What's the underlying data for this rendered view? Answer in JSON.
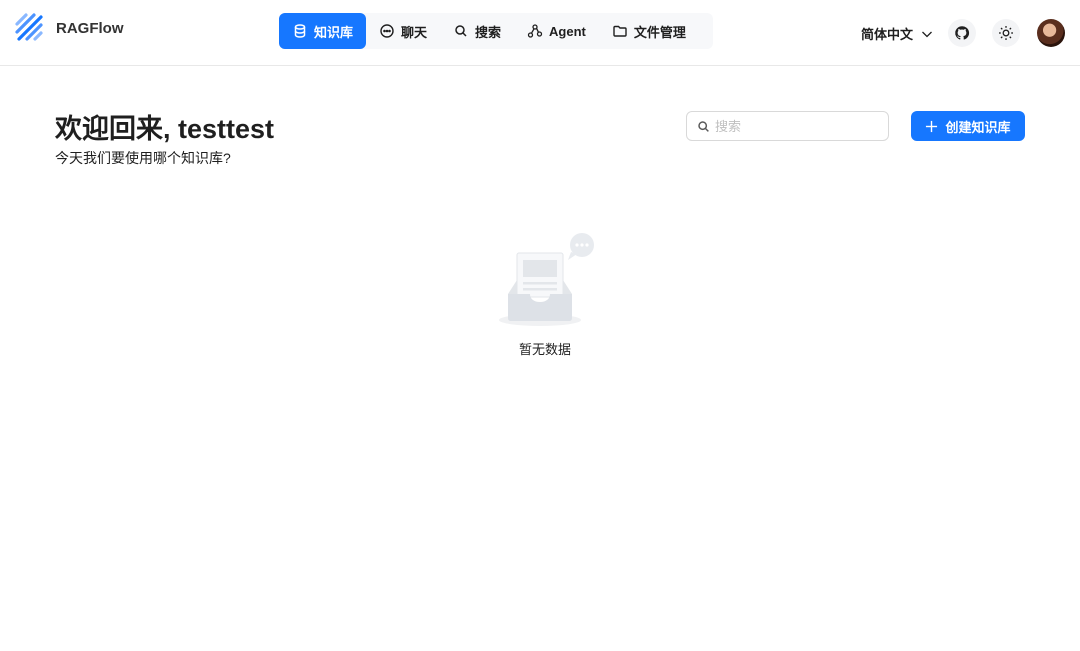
{
  "app": {
    "name": "RAGFlow"
  },
  "nav": {
    "items": [
      {
        "label": "知识库",
        "icon": "database-icon",
        "active": true
      },
      {
        "label": "聊天",
        "icon": "chat-icon",
        "active": false
      },
      {
        "label": "搜索",
        "icon": "search-icon",
        "active": false
      },
      {
        "label": "Agent",
        "icon": "agent-graph-icon",
        "active": false
      },
      {
        "label": "文件管理",
        "icon": "folder-icon",
        "active": false
      }
    ]
  },
  "header": {
    "language": "简体中文",
    "github_icon": "github-icon",
    "theme_icon": "sun-icon"
  },
  "main": {
    "welcome_title": "欢迎回来, testtest",
    "welcome_subtitle": "今天我们要使用哪个知识库?",
    "search_placeholder": "搜索",
    "create_label": "创建知识库",
    "empty_text": "暂无数据"
  },
  "colors": {
    "primary": "#1677ff",
    "border": "#e8e8e8"
  }
}
